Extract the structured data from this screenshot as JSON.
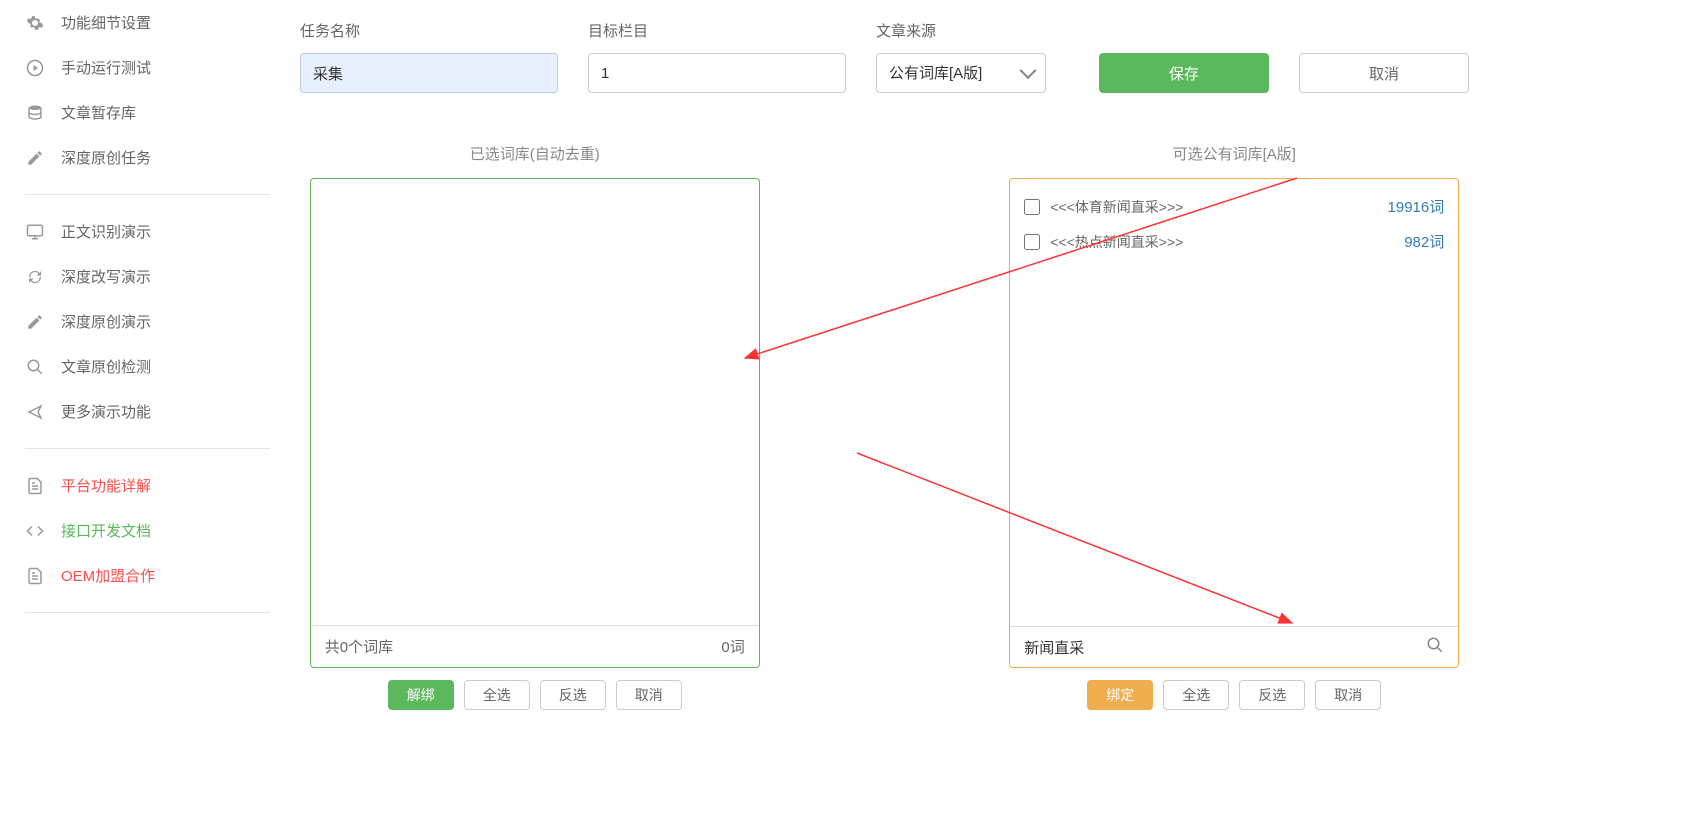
{
  "sidebar": {
    "group1": [
      {
        "icon": "gear",
        "label": "功能细节设置"
      },
      {
        "icon": "play",
        "label": "手动运行测试"
      },
      {
        "icon": "database",
        "label": "文章暂存库"
      },
      {
        "icon": "edit",
        "label": "深度原创任务"
      }
    ],
    "group2": [
      {
        "icon": "monitor",
        "label": "正文识别演示"
      },
      {
        "icon": "refresh",
        "label": "深度改写演示"
      },
      {
        "icon": "edit",
        "label": "深度原创演示"
      },
      {
        "icon": "search",
        "label": "文章原创检测"
      },
      {
        "icon": "share",
        "label": "更多演示功能"
      }
    ],
    "group3": [
      {
        "icon": "doc",
        "label": "平台功能详解",
        "color": "red"
      },
      {
        "icon": "code",
        "label": "接口开发文档",
        "color": "green"
      },
      {
        "icon": "doc",
        "label": "OEM加盟合作",
        "color": "red"
      }
    ]
  },
  "form": {
    "task_name_label": "任务名称",
    "task_name_value": "采集",
    "target_label": "目标栏目",
    "target_value": "1",
    "source_label": "文章来源",
    "source_value": "公有词库[A版]",
    "save": "保存",
    "cancel": "取消"
  },
  "left_panel": {
    "title": "已选词库(自动去重)",
    "footer_left": "共0个词库",
    "footer_right": "0词",
    "btns": {
      "unbind": "解绑",
      "select_all": "全选",
      "invert": "反选",
      "cancel": "取消"
    }
  },
  "right_panel": {
    "title": "可选公有词库[A版]",
    "items": [
      {
        "name": "<<<体育新闻直采>>>",
        "count": "19916词"
      },
      {
        "name": "<<<热点新闻直采>>>",
        "count": "982词"
      }
    ],
    "search_value": "新闻直采",
    "btns": {
      "bind": "绑定",
      "select_all": "全选",
      "invert": "反选",
      "cancel": "取消"
    }
  }
}
